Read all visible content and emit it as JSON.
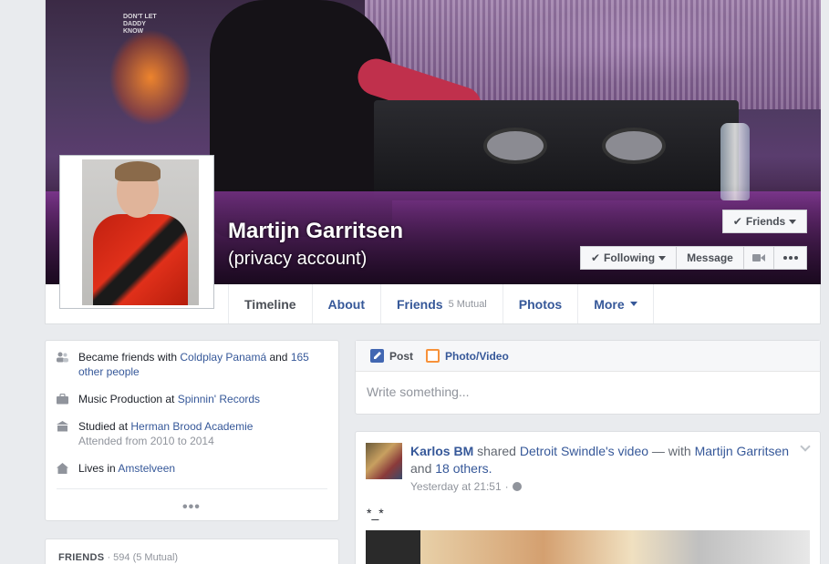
{
  "profile": {
    "name": "Martijn Garritsen",
    "subtitle": "(privacy account)"
  },
  "cover_buttons": {
    "friends": "Friends",
    "following": "Following",
    "message": "Message"
  },
  "tabs": [
    {
      "label": "Timeline"
    },
    {
      "label": "About"
    },
    {
      "label": "Friends",
      "sub": "5 Mutual"
    },
    {
      "label": "Photos"
    },
    {
      "label": "More"
    }
  ],
  "intro": {
    "friends": {
      "prefix": "Became friends with ",
      "link1": "Coldplay Panamá",
      "mid": " and ",
      "link2": "165 other people"
    },
    "work": {
      "prefix": "Music Production at ",
      "link": "Spinnin' Records"
    },
    "school": {
      "prefix": "Studied at ",
      "link": "Herman Brood Academie",
      "detail": "Attended from 2010 to 2014"
    },
    "lives": {
      "prefix": "Lives in ",
      "link": "Amstelveen"
    },
    "more": "•••"
  },
  "friends_card": {
    "title": "FRIENDS",
    "count": " · 594 (5 Mutual)"
  },
  "composer": {
    "post_tab": "Post",
    "photo_tab": "Photo/Video",
    "placeholder": "Write something..."
  },
  "story": {
    "actor": "Karlos BM",
    "verb": " shared ",
    "source": "Detroit Swindle",
    "object": "'s video",
    "with": " — with ",
    "tagged": "Martijn Garritsen",
    "and": " and ",
    "others": "18 others",
    "period": ".",
    "time": "Yesterday at 21:51",
    "sep": " · ",
    "body": "*_*"
  }
}
